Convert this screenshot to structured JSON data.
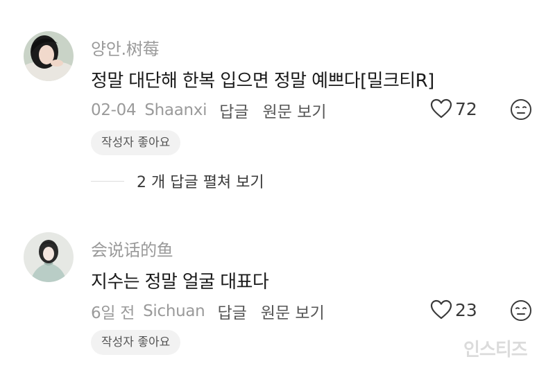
{
  "comments": [
    {
      "username": "양안.树莓",
      "text": "정말 대단해 한복 입으면 정말 예쁘다[밀크티R]",
      "date": "02-04",
      "location": "Shaanxi",
      "reply_label": "답글",
      "original_label": "원문 보기",
      "like_count": "72",
      "author_liked": "작성자 좋아요",
      "replies_label": "2 개 답글 펼쳐 보기"
    },
    {
      "username": "会说话的鱼",
      "text": "지수는 정말 얼굴 대표다",
      "date": "6일 전",
      "location": "Sichuan",
      "reply_label": "답글",
      "original_label": "원문 보기",
      "like_count": "23",
      "author_liked": "작성자 좋아요"
    }
  ],
  "watermark": "인스티즈",
  "icons": {
    "like": "heart-outline-icon",
    "reaction": "neutral-face-icon"
  },
  "colors": {
    "username": "#9a9a9a",
    "meta": "#9a9a9a",
    "text": "#1a1a1a",
    "chip_bg": "#f2f2f2"
  }
}
